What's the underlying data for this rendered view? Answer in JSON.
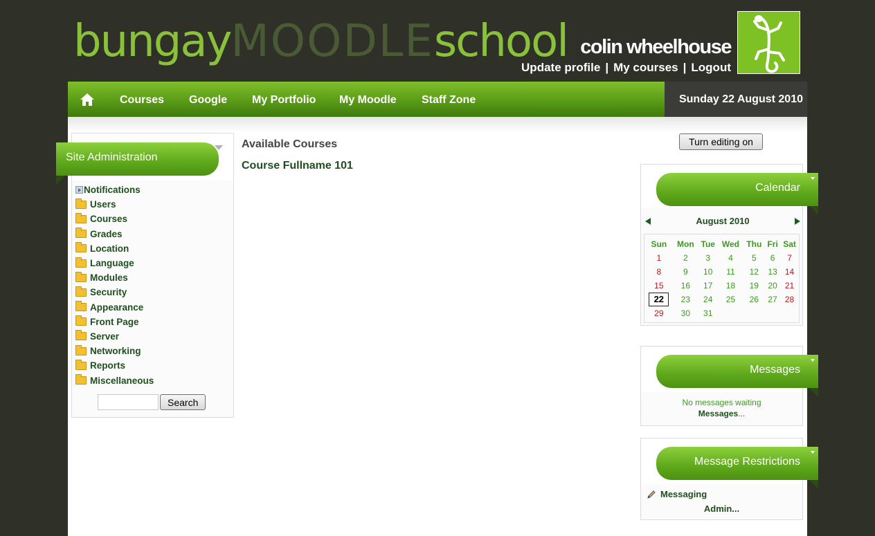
{
  "header": {
    "logo_part1": "bungay",
    "logo_part2": "MOODLE",
    "logo_part3": "school",
    "user_name": "colin wheelhouse",
    "links": [
      "Update profile",
      "My courses",
      "Logout"
    ]
  },
  "nav": {
    "items": [
      "Courses",
      "Google",
      "My Portfolio",
      "My Moodle",
      "Staff Zone"
    ],
    "date": "Sunday 22 August 2010"
  },
  "admin": {
    "title": "Site Administration",
    "items": [
      "Notifications",
      "Users",
      "Courses",
      "Grades",
      "Location",
      "Language",
      "Modules",
      "Security",
      "Appearance",
      "Front Page",
      "Server",
      "Networking",
      "Reports",
      "Miscellaneous"
    ],
    "search_button": "Search",
    "search_value": ""
  },
  "main": {
    "heading": "Available Courses",
    "course": "Course Fullname 101"
  },
  "editing_button": "Turn editing on",
  "calendar": {
    "title": "Calendar",
    "month": "August 2010",
    "weekdays": [
      "Sun",
      "Mon",
      "Tue",
      "Wed",
      "Thu",
      "Fri",
      "Sat"
    ],
    "weeks": [
      [
        "1",
        "2",
        "3",
        "4",
        "5",
        "6",
        "7"
      ],
      [
        "8",
        "9",
        "10",
        "11",
        "12",
        "13",
        "14"
      ],
      [
        "15",
        "16",
        "17",
        "18",
        "19",
        "20",
        "21"
      ],
      [
        "22",
        "23",
        "24",
        "25",
        "26",
        "27",
        "28"
      ],
      [
        "29",
        "30",
        "31",
        "",
        "",
        "",
        ""
      ]
    ],
    "today": "22"
  },
  "messages": {
    "title": "Messages",
    "status": "No messages waiting",
    "link": "Messages",
    "link_suffix": "..."
  },
  "restrictions": {
    "title": "Message Restrictions",
    "item": "Messaging",
    "admin_link": "Admin..."
  },
  "colors": {
    "accent_green": "#6cb31f",
    "link_green": "#1f4e1f",
    "weekend_red": "#c0141a",
    "background_dark": "#2f3129"
  }
}
